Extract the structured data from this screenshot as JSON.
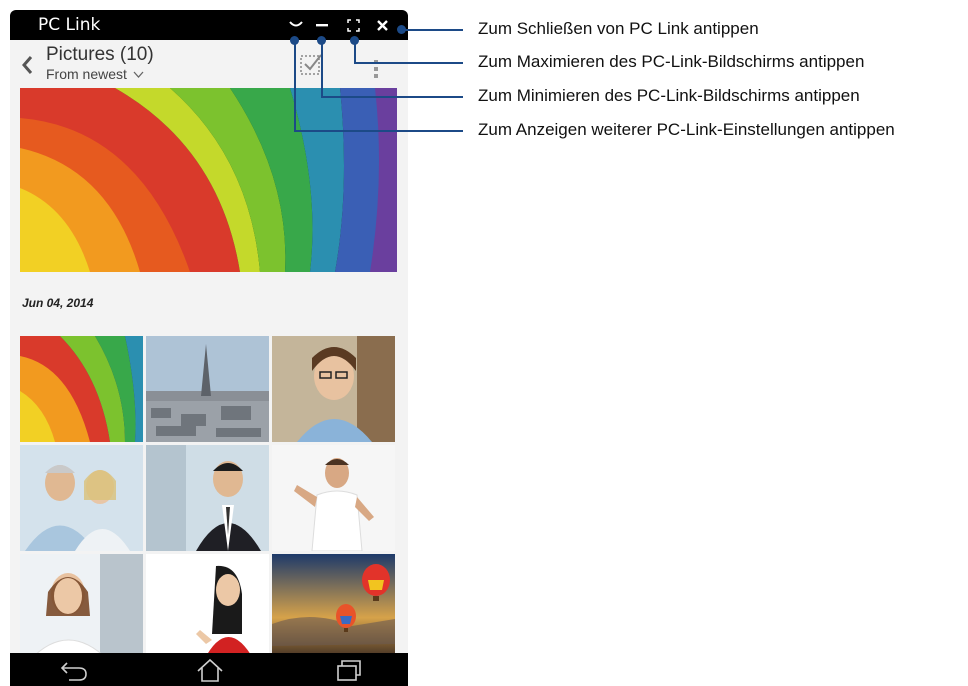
{
  "window": {
    "title": "PC Link",
    "settings_icon": "chevron-down-icon",
    "minimize_icon": "minus-icon",
    "maximize_icon": "expand-icon",
    "close_icon": "close-icon"
  },
  "gallery": {
    "album_title": "Pictures (10)",
    "sort_label": "From newest",
    "date_label": "Jun 04, 2014",
    "thumbnails": [
      "colorful-paper",
      "paris-city",
      "woman-glasses",
      "elderly-couple",
      "businessman",
      "man-white-shirt",
      "smiling-woman",
      "woman-red-dress",
      "hot-air-balloons"
    ]
  },
  "navbar": {
    "back_icon": "back-arrow-icon",
    "home_icon": "home-icon",
    "recent_icon": "recent-apps-icon"
  },
  "callouts": {
    "close": "Zum Schließen von PC Link antippen",
    "maximize": "Zum Maximieren des PC-Link-Bildschirms antippen",
    "minimize": "Zum Minimieren des PC-Link-Bildschirms antippen",
    "settings": "Zum Anzeigen weiterer PC-Link-Einstellungen antippen"
  },
  "colors": {
    "accent": "#1c4a87",
    "titlebar": "#000000",
    "background": "#f3f3f3"
  }
}
